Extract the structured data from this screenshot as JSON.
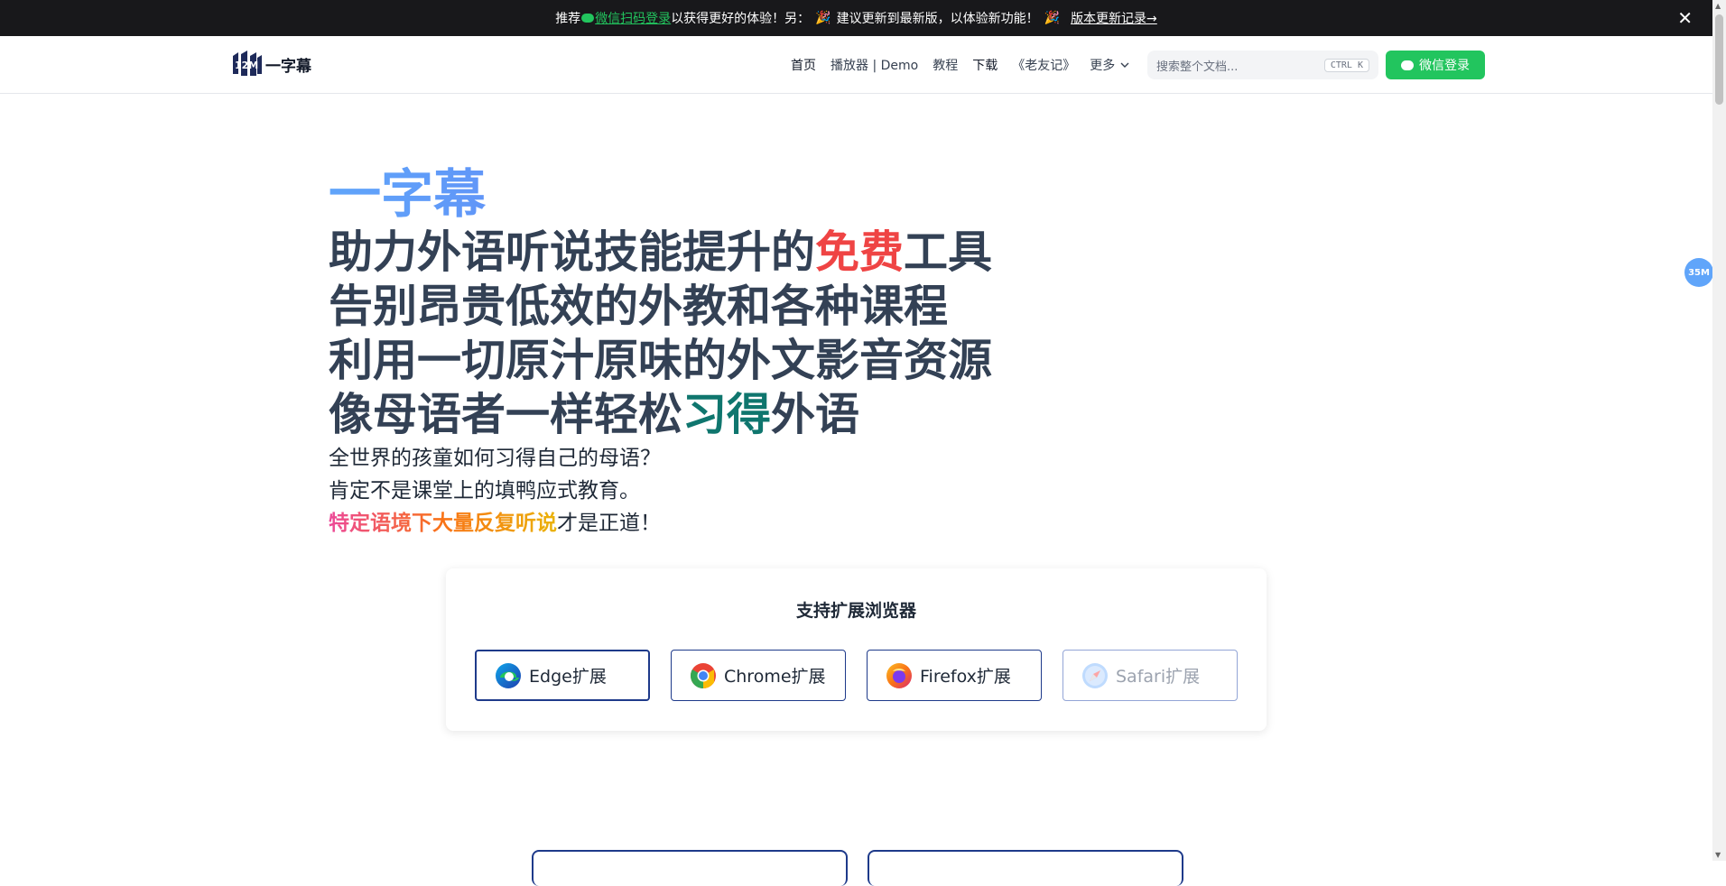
{
  "banner": {
    "prefix": "推荐",
    "login_link": "微信扫码登录",
    "middle": "以获得更好的体验！另：",
    "update_text": "建议更新到最新版，以体验新功能！",
    "changelog_link": "版本更新记录→",
    "close": "✕"
  },
  "navbar": {
    "logo_text": "一字幕",
    "items": [
      "首页",
      "播放器 | Demo",
      "教程",
      "下载",
      "《老友记》"
    ],
    "more_label": "更多",
    "search_placeholder": "搜索整个文档...",
    "search_shortcut": "CTRL K",
    "login_button": "微信登录"
  },
  "hero": {
    "brand": "一字幕",
    "line1_a": "助力外语听说技能提升的",
    "line1_red": "免费",
    "line1_b": "工具",
    "line2": "告别昂贵低效的外教和各种课程",
    "line3": "利用一切原汁原味的外文影音资源",
    "line4_a": "像母语者一样轻松",
    "line4_teal": "习得",
    "line4_b": "外语",
    "sub1": "全世界的孩童如何习得自己的母语？",
    "sub2": "肯定不是课堂上的填鸭应式教育。",
    "sub3_grad": "特定语境下大量反复听说",
    "sub3_rest": "才是正道！"
  },
  "browsers": {
    "title": "支持扩展浏览器",
    "items": [
      {
        "label": "Edge扩展",
        "icon": "edge-icon"
      },
      {
        "label": "Chrome扩展",
        "icon": "chrome-icon"
      },
      {
        "label": "Firefox扩展",
        "icon": "firefox-icon"
      },
      {
        "label": "Safari扩展",
        "icon": "safari-icon"
      }
    ]
  },
  "float_badge": "35M",
  "colors": {
    "accent_green": "#22c55e",
    "highlight_red": "#ef4444",
    "highlight_teal": "#0f766e",
    "border_navy": "#1e3a8a"
  }
}
